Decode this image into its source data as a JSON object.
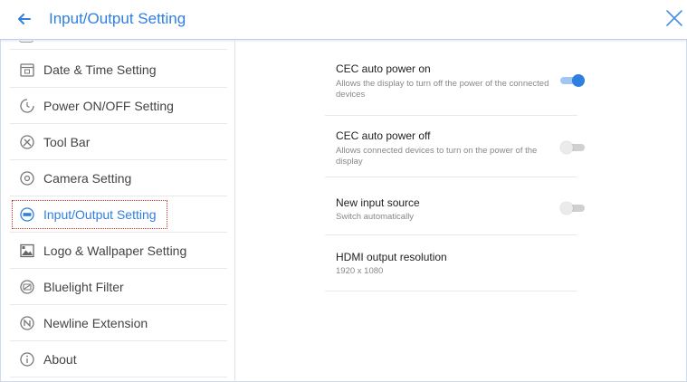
{
  "header": {
    "title": "Input/Output Setting"
  },
  "colors": {
    "accent": "#2f7fe0",
    "highlight_box": "#d9302b"
  },
  "sidebar": {
    "items": [
      {
        "label": "Date & Time Setting",
        "icon": "calendar-icon"
      },
      {
        "label": "Power ON/OFF Setting",
        "icon": "timer-icon"
      },
      {
        "label": "Tool Bar",
        "icon": "tools-icon"
      },
      {
        "label": "Camera Setting",
        "icon": "camera-icon"
      },
      {
        "label": "Input/Output Setting",
        "icon": "input-output-icon",
        "active": true
      },
      {
        "label": "Logo & Wallpaper Setting",
        "icon": "image-icon"
      },
      {
        "label": "Bluelight Filter",
        "icon": "bluelight-icon"
      },
      {
        "label": "Newline Extension",
        "icon": "extension-icon"
      },
      {
        "label": "About",
        "icon": "info-icon"
      }
    ]
  },
  "settings": {
    "cec_on": {
      "title": "CEC auto power on",
      "desc": "Allows the display to turn off the power of the connected devices",
      "enabled": true
    },
    "cec_off": {
      "title": "CEC auto power off",
      "desc": "Allows connected devices to turn on the power of the display",
      "enabled": false
    },
    "new_input": {
      "title": "New input source",
      "desc": "Switch automatically",
      "enabled": false
    },
    "hdmi": {
      "title": "HDMI output resolution",
      "value": "1920 x 1080"
    }
  }
}
